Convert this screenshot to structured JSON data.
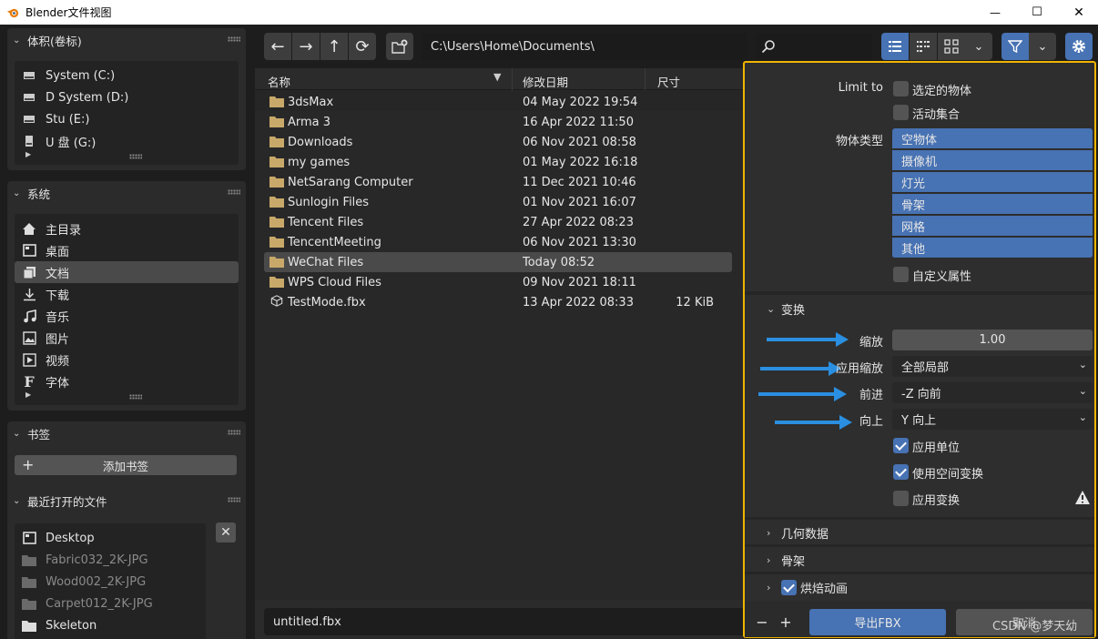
{
  "window": {
    "title": "Blender文件视图",
    "minimize": "—",
    "maximize": "☐",
    "close": "✕"
  },
  "volumes": {
    "header": "体积(卷标)",
    "items": [
      {
        "label": "System (C:)",
        "icon": "drive-icon"
      },
      {
        "label": "D System (D:)",
        "icon": "drive-icon"
      },
      {
        "label": "Stu (E:)",
        "icon": "drive-icon"
      },
      {
        "label": "U 盘 (G:)",
        "icon": "usb-drive-icon"
      }
    ]
  },
  "system": {
    "header": "系统",
    "items": [
      {
        "label": "主目录",
        "icon": "home-icon"
      },
      {
        "label": "桌面",
        "icon": "desktop-icon"
      },
      {
        "label": "文档",
        "icon": "documents-icon",
        "selected": true
      },
      {
        "label": "下载",
        "icon": "download-icon"
      },
      {
        "label": "音乐",
        "icon": "music-icon"
      },
      {
        "label": "图片",
        "icon": "image-icon"
      },
      {
        "label": "视频",
        "icon": "video-icon"
      },
      {
        "label": "字体",
        "icon": "font-icon"
      }
    ]
  },
  "bookmarks": {
    "header": "书签",
    "add_label": "添加书签",
    "add_icon": "+"
  },
  "recent": {
    "header": "最近打开的文件",
    "items": [
      {
        "label": "Desktop",
        "dim": false
      },
      {
        "label": "Fabric032_2K-JPG",
        "dim": true
      },
      {
        "label": "Wood002_2K-JPG",
        "dim": true
      },
      {
        "label": "Carpet012_2K-JPG",
        "dim": true
      },
      {
        "label": "Skeleton",
        "dim": false
      }
    ]
  },
  "toolbar": {
    "path": "C:\\Users\\Home\\Documents\\",
    "search_placeholder": ""
  },
  "files": {
    "columns": {
      "name": "名称",
      "date": "修改日期",
      "size": "尺寸"
    },
    "rows": [
      {
        "name": "3dsMax",
        "date": "04 May 2022 19:54",
        "size": "",
        "type": "folder"
      },
      {
        "name": "Arma 3",
        "date": "16 Apr 2022 11:50",
        "size": "",
        "type": "folder"
      },
      {
        "name": "Downloads",
        "date": "06 Nov 2021 08:58",
        "size": "",
        "type": "folder"
      },
      {
        "name": "my games",
        "date": "01 May 2022 16:18",
        "size": "",
        "type": "folder"
      },
      {
        "name": "NetSarang Computer",
        "date": "11 Dec 2021 10:46",
        "size": "",
        "type": "folder"
      },
      {
        "name": "Sunlogin Files",
        "date": "01 Nov 2021 16:07",
        "size": "",
        "type": "folder"
      },
      {
        "name": "Tencent Files",
        "date": "27 Apr 2022 08:23",
        "size": "",
        "type": "folder"
      },
      {
        "name": "TencentMeeting",
        "date": "06 Nov 2021 13:30",
        "size": "",
        "type": "folder"
      },
      {
        "name": "WeChat Files",
        "date": "Today 08:52",
        "size": "",
        "type": "folder",
        "selected": true
      },
      {
        "name": "WPS Cloud Files",
        "date": "09 Nov 2021 18:11",
        "size": "",
        "type": "folder"
      },
      {
        "name": "TestMode.fbx",
        "date": "13 Apr 2022 08:33",
        "size": "12 KiB",
        "type": "file"
      }
    ]
  },
  "filename": "untitled.fbx",
  "options": {
    "limit_to_label": "Limit to",
    "limit_selected": "选定的物体",
    "limit_active": "活动集合",
    "object_types_label": "物体类型",
    "object_types": [
      "空物体",
      "摄像机",
      "灯光",
      "骨架",
      "网格",
      "其他"
    ],
    "custom_props": "自定义属性",
    "transform_header": "变换",
    "scale_label": "缩放",
    "scale_value": "1.00",
    "apply_scale_label": "应用缩放",
    "apply_scale_value": "全部局部",
    "forward_label": "前进",
    "forward_value": "-Z 向前",
    "up_label": "向上",
    "up_value": "Y 向上",
    "apply_unit": "应用单位",
    "use_space_transform": "使用空间变换",
    "apply_transform": "应用变换",
    "geometry_header": "几何数据",
    "armature_header": "骨架",
    "bake_anim_header": "烘焙动画"
  },
  "footer": {
    "export_label": "导出FBX",
    "cancel_label": "取消",
    "watermark": "CSDN @梦天幼"
  },
  "colors": {
    "accent": "#4772b3",
    "highlight_border": "#f0b400",
    "arrow": "#2a8fe0"
  }
}
